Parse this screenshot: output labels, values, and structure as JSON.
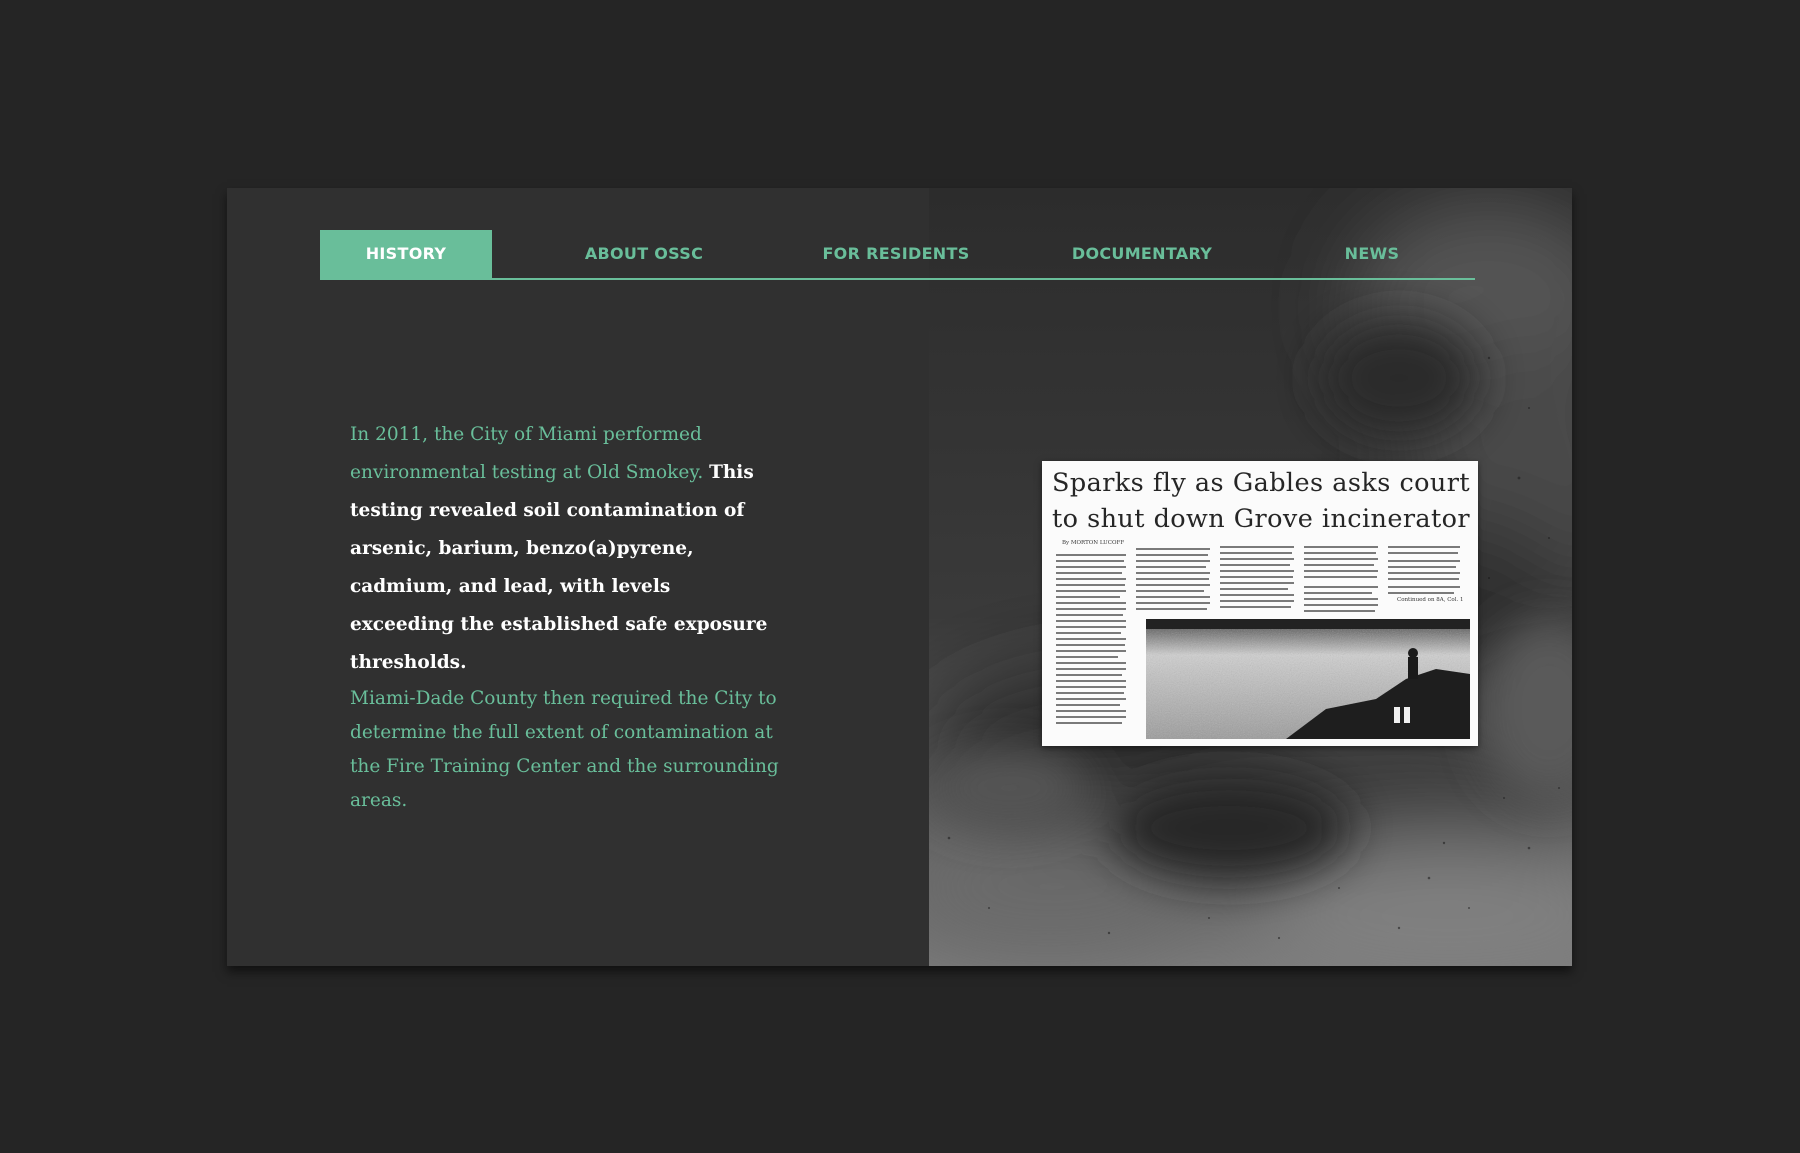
{
  "nav": {
    "items": [
      {
        "label": "HISTORY",
        "active": true
      },
      {
        "label": "ABOUT OSSC",
        "active": false
      },
      {
        "label": "FOR RESIDENTS",
        "active": false
      },
      {
        "label": "DOCUMENTARY",
        "active": false
      },
      {
        "label": "NEWS",
        "active": false
      }
    ]
  },
  "content": {
    "intro": "In 2011, the City of Miami performed environmental testing at Old Smokey.",
    "highlight": "This testing revealed soil contamination of arsenic, barium, benzo(a)pyrene, cadmium, and lead, with levels exceeding the established safe exposure thresholds.",
    "followup": "Miami-Dade County then required the City to determine the full extent of contamination at the Fire Training Center and the surrounding areas."
  },
  "clipping": {
    "headline": "Sparks fly as Gables asks court to shut down Grove incinerator",
    "byline": "By MORTON LUCOFF",
    "continued": "Continued on 8A, Col. 1"
  },
  "colors": {
    "accent": "#69be9a",
    "page_background": "#252525",
    "panel_background": "#303030"
  }
}
